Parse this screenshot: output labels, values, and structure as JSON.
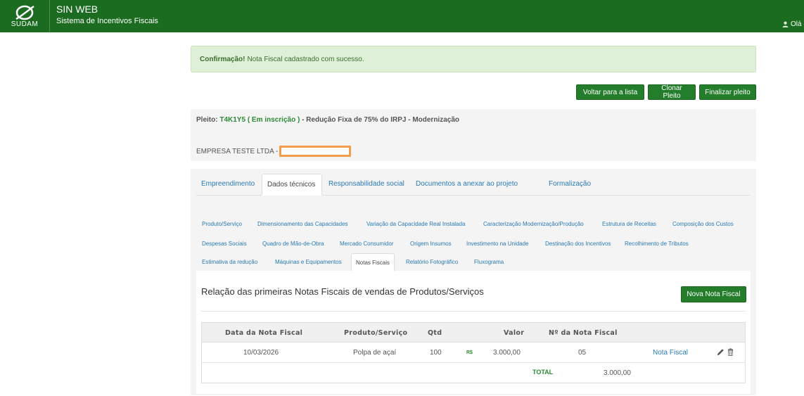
{
  "header": {
    "logo_text": "SUDAM",
    "app_name": "SIN WEB",
    "app_subtitle": "Sistema de Incentivos Fiscais",
    "user_greeting": "Olá E"
  },
  "alert": {
    "strong": "Confirmação!",
    "message": "Nota Fiscal cadastrado com sucesso."
  },
  "actions": {
    "back": "Voltar para a lista",
    "clone": "Clonar Pleito",
    "finish": "Finalizar pleito"
  },
  "pleito": {
    "prefix": "Pleito:",
    "code": "T4K1Y5",
    "status": "( Em inscrição )",
    "description": "- Redução Fixa de 75% do IRPJ - Modernização",
    "company": "EMPRESA TESTE LTDA -"
  },
  "main_tabs": [
    {
      "label": "Empreendimento"
    },
    {
      "label": "Dados técnicos",
      "active": true
    },
    {
      "label": "Responsabilidade social"
    },
    {
      "label": "Documentos a anexar ao projeto"
    },
    {
      "label": "Formalização"
    }
  ],
  "sub_tabs": [
    {
      "label": "Produto/Serviço"
    },
    {
      "label": "Dimensionamento das Capacidades"
    },
    {
      "label": "Variação da Capacidade Real Instalada"
    },
    {
      "label": "Caracterização Modernização/Produção"
    },
    {
      "label": "Estrutura de Receitas"
    },
    {
      "label": "Composição dos Custos"
    },
    {
      "label": "Despesas Sociais"
    },
    {
      "label": "Quadro de Mão-de-Obra"
    },
    {
      "label": "Mercado Consumidor"
    },
    {
      "label": "Origem Insumos"
    },
    {
      "label": "Investimento na Unidade"
    },
    {
      "label": "Destinação dos Incentivos"
    },
    {
      "label": "Recolhimento de Tributos"
    },
    {
      "label": "Estimativa da redução"
    },
    {
      "label": "Máquinas e Equipamentos"
    },
    {
      "label": "Notas Fiscais",
      "active": true
    },
    {
      "label": "Relatório Fotográfico"
    },
    {
      "label": "Fluxograma"
    }
  ],
  "section": {
    "title": "Relação das primeiras Notas Fiscais de vendas de Produtos/Serviços",
    "new_button": "Nova Nota Fiscal"
  },
  "table": {
    "columns": [
      "Data da Nota Fiscal",
      "Produto/Serviço",
      "Qtd",
      "Valor",
      "Nº da Nota Fiscal"
    ],
    "rows": [
      {
        "date": "10/03/2026",
        "product": "Polpa de açaí",
        "qty": "100",
        "currency": "R$",
        "value": "3.000,00",
        "number": "05",
        "link": "Nota Fiscal"
      }
    ],
    "total_label": "TOTAL",
    "total_value": "3.000,00"
  },
  "icons": {
    "logo": "sudam-logo-icon",
    "user": "user-icon",
    "edit": "pencil-icon",
    "delete": "trash-icon"
  },
  "colors": {
    "header_bg": "#1b6b21",
    "button_bg": "#237d2a",
    "alert_bg": "#dff0d8",
    "link": "#2a7ab3"
  }
}
